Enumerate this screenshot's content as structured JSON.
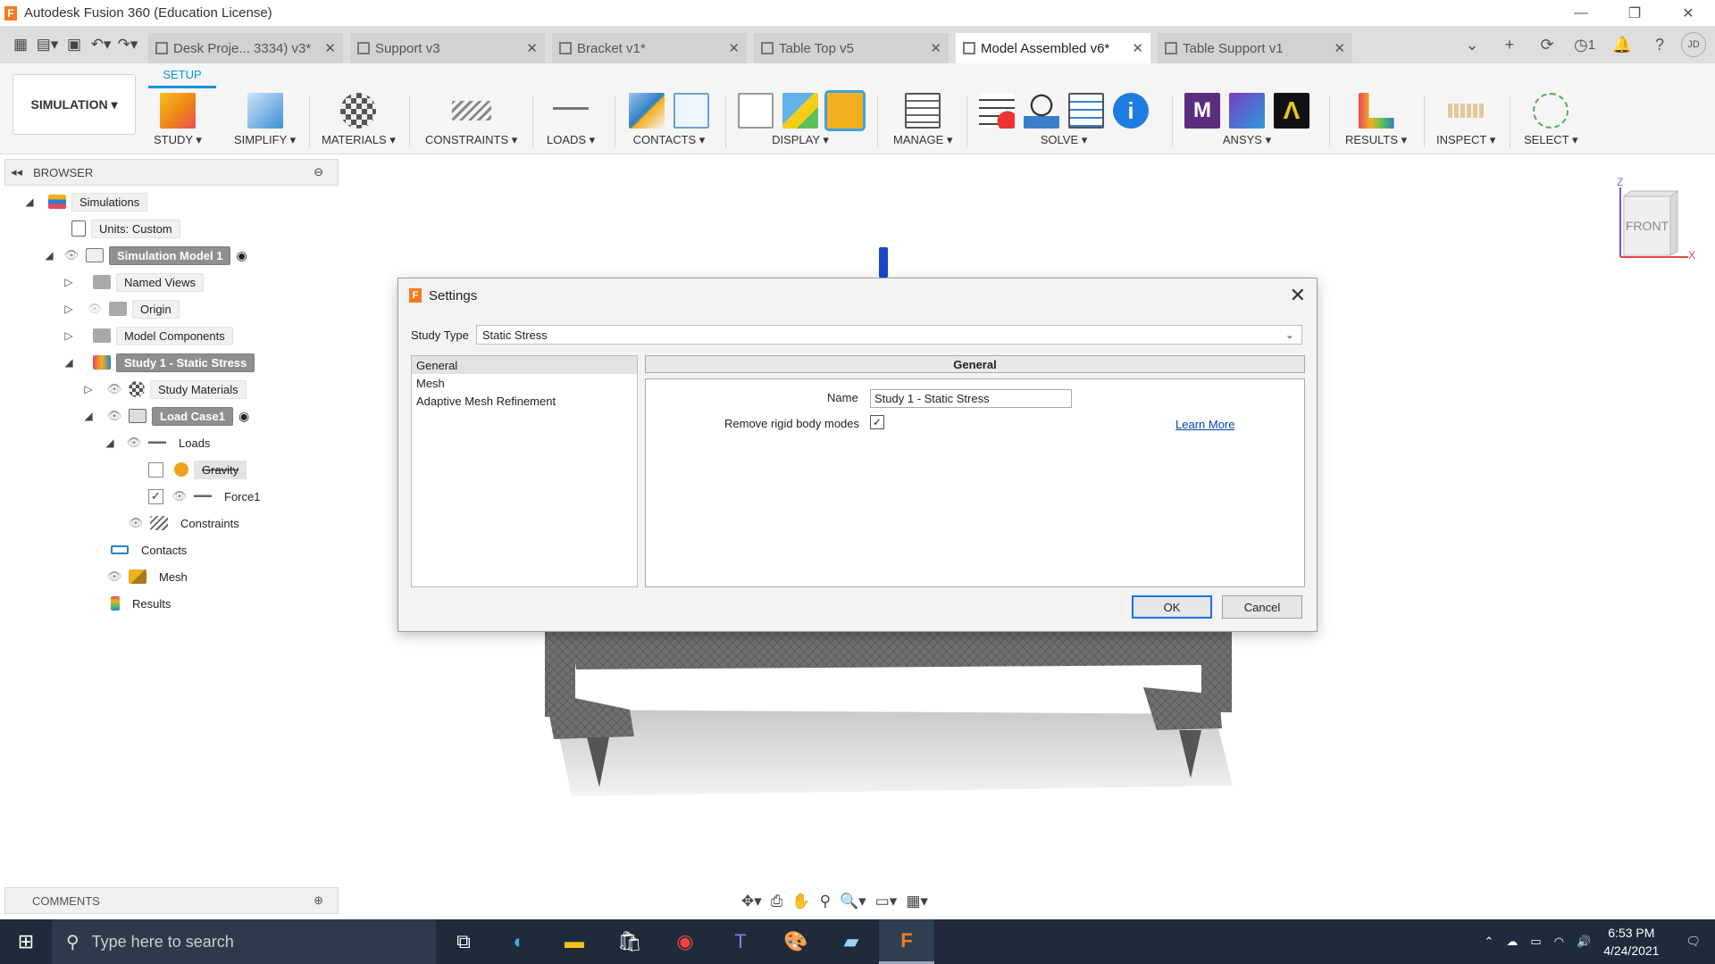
{
  "window": {
    "title": "Autodesk Fusion 360 (Education License)"
  },
  "tabs": [
    {
      "label": "Desk Proje... 3334) v3*",
      "active": false
    },
    {
      "label": "Support v3",
      "active": false
    },
    {
      "label": "Bracket v1*",
      "active": false
    },
    {
      "label": "Table Top v5",
      "active": false
    },
    {
      "label": "Model Assembled v6*",
      "active": true
    },
    {
      "label": "Table Support v1",
      "active": false
    }
  ],
  "top_right": {
    "job_count": "1",
    "user_initials": "JD"
  },
  "ribbon": {
    "workspace": "SIMULATION ▾",
    "active_tab": "SETUP",
    "groups": {
      "study": "STUDY ▾",
      "simplify": "SIMPLIFY ▾",
      "materials": "MATERIALS ▾",
      "constraints": "CONSTRAINTS ▾",
      "loads": "LOADS ▾",
      "contacts": "CONTACTS ▾",
      "display": "DISPLAY ▾",
      "manage": "MANAGE ▾",
      "solve": "SOLVE ▾",
      "ansys": "ANSYS ▾",
      "results": "RESULTS ▾",
      "inspect": "INSPECT ▾",
      "select": "SELECT ▾"
    }
  },
  "browser": {
    "title": "BROWSER",
    "nodes": {
      "simulations": "Simulations",
      "units": "Units: Custom",
      "sim_model": "Simulation Model 1",
      "named_views": "Named Views",
      "origin": "Origin",
      "model_components": "Model Components",
      "study": "Study 1 - Static Stress",
      "study_materials": "Study Materials",
      "load_case": "Load Case1",
      "loads": "Loads",
      "gravity": "Gravity",
      "force": "Force1",
      "constraints": "Constraints",
      "contacts": "Contacts",
      "mesh": "Mesh",
      "results": "Results"
    }
  },
  "comments": {
    "title": "COMMENTS"
  },
  "viewcube": {
    "face": "FRONT",
    "axis_z": "Z",
    "axis_x": "X"
  },
  "dialog": {
    "title": "Settings",
    "study_type_label": "Study Type",
    "study_type_value": "Static Stress",
    "sections": [
      "General",
      "Mesh",
      "Adaptive Mesh Refinement"
    ],
    "panel_header": "General",
    "name_label": "Name",
    "name_value": "Study 1 - Static Stress",
    "rigid_label": "Remove rigid body modes",
    "rigid_checked": true,
    "learn_more": "Learn More",
    "ok": "OK",
    "cancel": "Cancel"
  },
  "taskbar": {
    "search_placeholder": "Type here to search",
    "time": "6:53 PM",
    "date": "4/24/2021"
  },
  "colors": {
    "accent": "#0696d7",
    "selected_node": "#8f8f8f",
    "taskbar": "#1f2b3a"
  }
}
